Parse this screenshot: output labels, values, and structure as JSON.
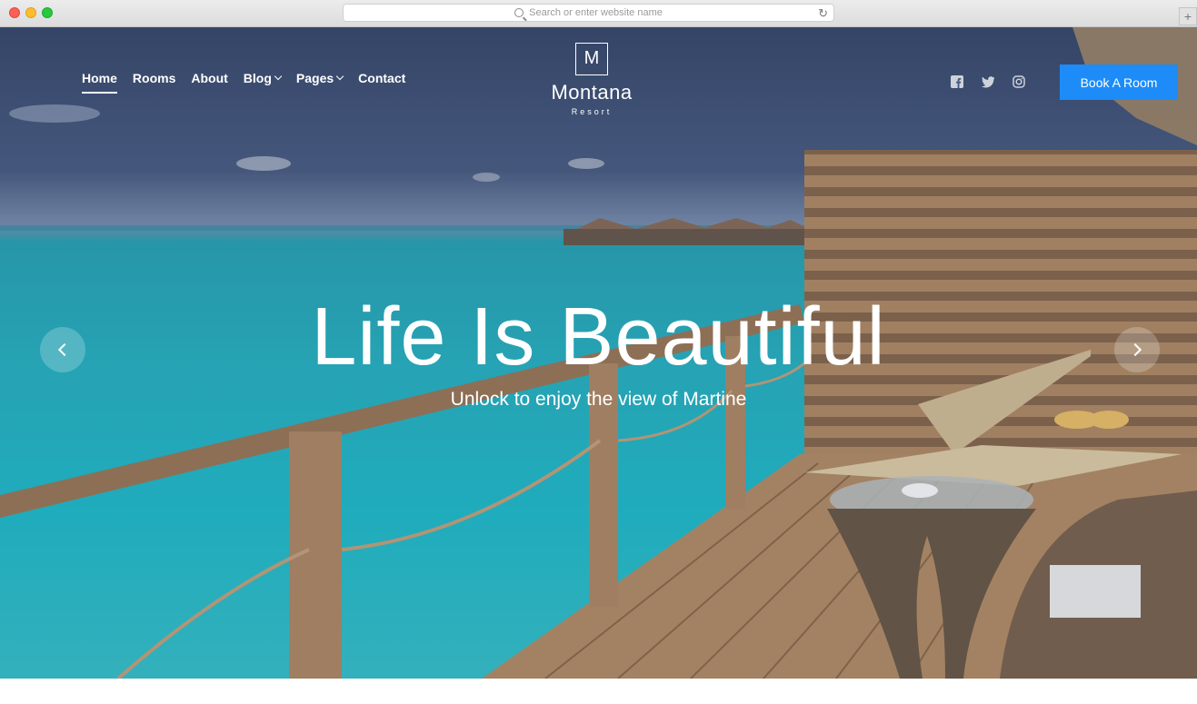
{
  "browser": {
    "url_placeholder": "Search or enter website name",
    "reload_icon": "reload-icon",
    "new_tab_label": "+"
  },
  "nav": {
    "items": [
      {
        "label": "Home",
        "active": true
      },
      {
        "label": "Rooms"
      },
      {
        "label": "About"
      },
      {
        "label": "Blog",
        "dropdown": true
      },
      {
        "label": "Pages",
        "dropdown": true
      },
      {
        "label": "Contact"
      }
    ]
  },
  "logo": {
    "letter": "M",
    "name": "Montana",
    "subtitle": "Resort"
  },
  "social": [
    "facebook-icon",
    "twitter-icon",
    "instagram-icon"
  ],
  "cta": {
    "label": "Book A Room",
    "color": "#1d8cf8"
  },
  "hero": {
    "headline": "Life Is Beautiful",
    "subline": "Unlock to enjoy the view of Martine"
  }
}
